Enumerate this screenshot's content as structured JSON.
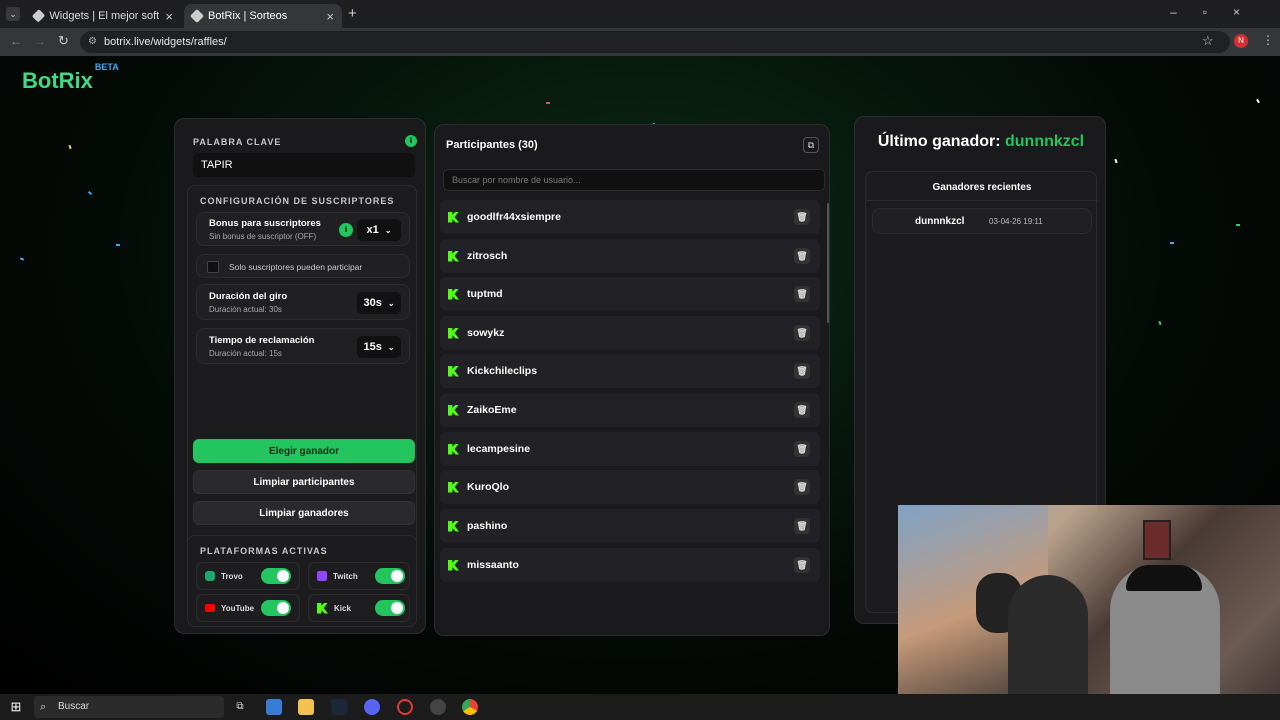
{
  "browser": {
    "tabs": [
      {
        "title": "Widgets | El mejor software pa"
      },
      {
        "title": "BotRix | Sorteos"
      }
    ],
    "url": "botrix.live/widgets/raffles/",
    "profile_initial": "N"
  },
  "app": {
    "logo": "BotRix",
    "badge": "BETA"
  },
  "settings": {
    "keyword_label": "PALABRA CLAVE",
    "keyword_value": "TAPIR",
    "subs_title": "CONFIGURACIÓN DE SUSCRIPTORES",
    "bonus_label": "Bonus para suscriptores",
    "bonus_sub": "Sin bonus de suscriptor (OFF)",
    "bonus_value": "x1",
    "subs_only": "Solo suscriptores pueden participar",
    "spin_label": "Duración del giro",
    "spin_sub": "Duración actual: 30s",
    "spin_value": "30s",
    "claim_label": "Tiempo de reclamación",
    "claim_sub": "Duración actual: 15s",
    "claim_value": "15s",
    "btn_pick": "Elegir ganador",
    "btn_clear_participants": "Limpiar participantes",
    "btn_clear_winners": "Limpiar ganadores",
    "platforms_title": "PLATAFORMAS ACTIVAS",
    "platforms": [
      {
        "name": "Trovo"
      },
      {
        "name": "Twitch"
      },
      {
        "name": "YouTube"
      },
      {
        "name": "Kick"
      }
    ]
  },
  "participants": {
    "title": "Participantes (30)",
    "search_placeholder": "Buscar por nombre de usuario...",
    "list": [
      "goodlfr44xsiempre",
      "zitrosch",
      "tuptmd",
      "sowykz",
      "Kickchileclips",
      "ZaikoEme",
      "lecampesine",
      "KuroQlo",
      "pashino",
      "missaanto"
    ]
  },
  "winner": {
    "title_prefix": "Último ganador:",
    "name": "dunnnkzcl",
    "recent_title": "Ganadores recientes",
    "recent": [
      {
        "name": "dunnnkzcl",
        "date": "03-04-26 19:11"
      }
    ]
  },
  "taskbar": {
    "search": "Buscar"
  },
  "colors": {
    "accent": "#22c55e",
    "kick": "#53fc18"
  }
}
